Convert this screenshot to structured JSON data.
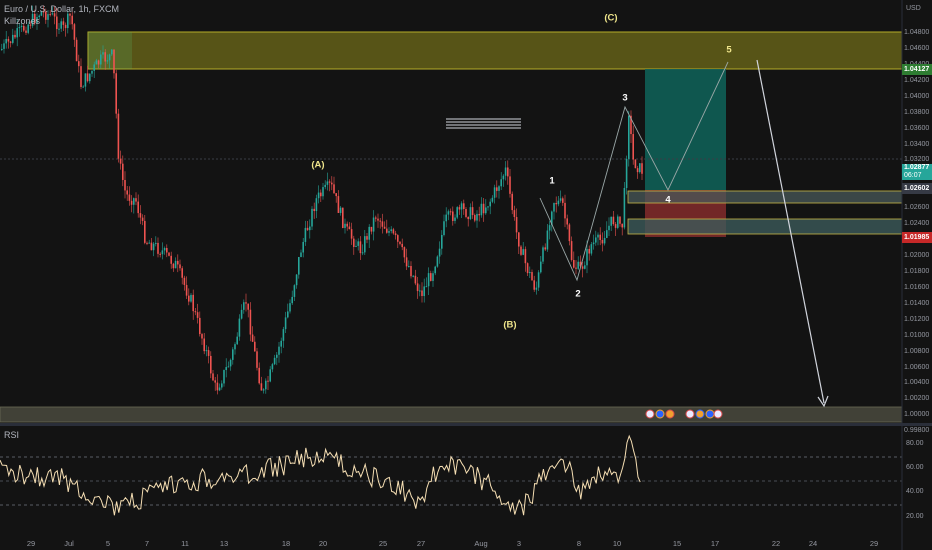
{
  "header": {
    "symbol_line": "Euro / U.S. Dollar, 1h, FXCM",
    "indicator_name": "Killzones",
    "currency": "USD"
  },
  "price_axis": {
    "ticks": [
      "1.04800",
      "1.04600",
      "1.04400",
      "1.04200",
      "1.04000",
      "1.03800",
      "1.03600",
      "1.03400",
      "1.03200",
      "1.03000",
      "1.02800",
      "1.02600",
      "1.02400",
      "1.02200",
      "1.02000",
      "1.01800",
      "1.01600",
      "1.01400",
      "1.01200",
      "1.01000",
      "1.00800",
      "1.00600",
      "1.00400",
      "1.00200",
      "1.00000",
      "0.99800"
    ],
    "tags": {
      "target": "1.04127",
      "current_price": "1.02877",
      "current_countdown": "06:07",
      "entry": "1.02602",
      "stop": "1.01985"
    }
  },
  "time_axis": {
    "ticks": [
      "29",
      "Jul",
      "5",
      "7",
      "11",
      "13",
      "18",
      "20",
      "25",
      "27",
      "Aug",
      "3",
      "8",
      "10",
      "15",
      "17",
      "22",
      "24",
      "29"
    ]
  },
  "rsi": {
    "title": "RSI",
    "ticks": [
      "80.00",
      "60.00",
      "40.00",
      "20.00"
    ]
  },
  "waves": {
    "A": "(A)",
    "B": "(B)",
    "C": "(C)",
    "w1": "1",
    "w2": "2",
    "w3": "3",
    "w4": "4",
    "w5": "5"
  },
  "colors": {
    "background": "#131313",
    "bull_candle": "#26a69a",
    "bear_candle": "#ef5350",
    "supply_zone": "#8f8a1c",
    "long_target_zone": "#0f5f56",
    "stop_zone": "#7d2a2a",
    "rsi_line": "#f5deb3",
    "wave_label": "#f0e68c"
  }
}
